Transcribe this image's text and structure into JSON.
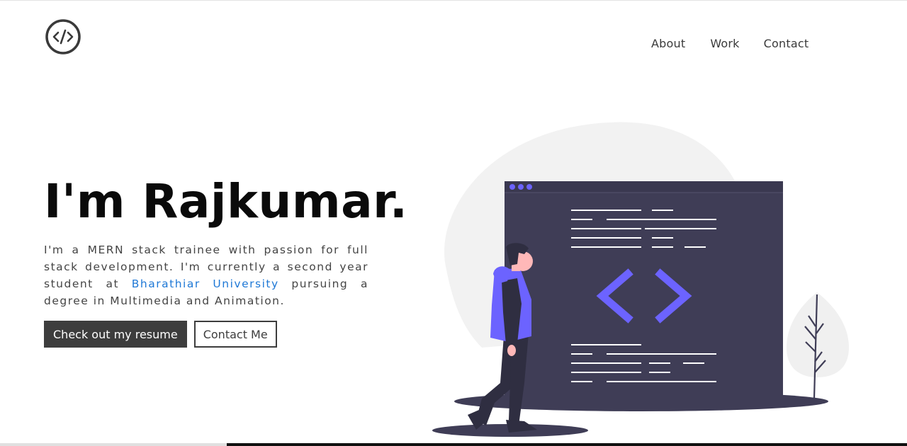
{
  "header": {
    "logo_icon": "code-slash-icon",
    "nav": [
      {
        "label": "About"
      },
      {
        "label": "Work"
      },
      {
        "label": "Contact"
      }
    ]
  },
  "hero": {
    "title": "I'm Rajkumar.",
    "intro_before": "I'm a MERN stack trainee with passion for full stack development. I'm currently a second year student at ",
    "university": "Bharathiar University",
    "intro_after": " pursuing a degree in Multimedia and Animation.",
    "resume_button": "Check out my resume",
    "contact_button": "Contact Me"
  },
  "illustration": {
    "icon": "developer-illustration",
    "accent_color": "#6c63ff",
    "screen_color": "#3f3d56"
  }
}
